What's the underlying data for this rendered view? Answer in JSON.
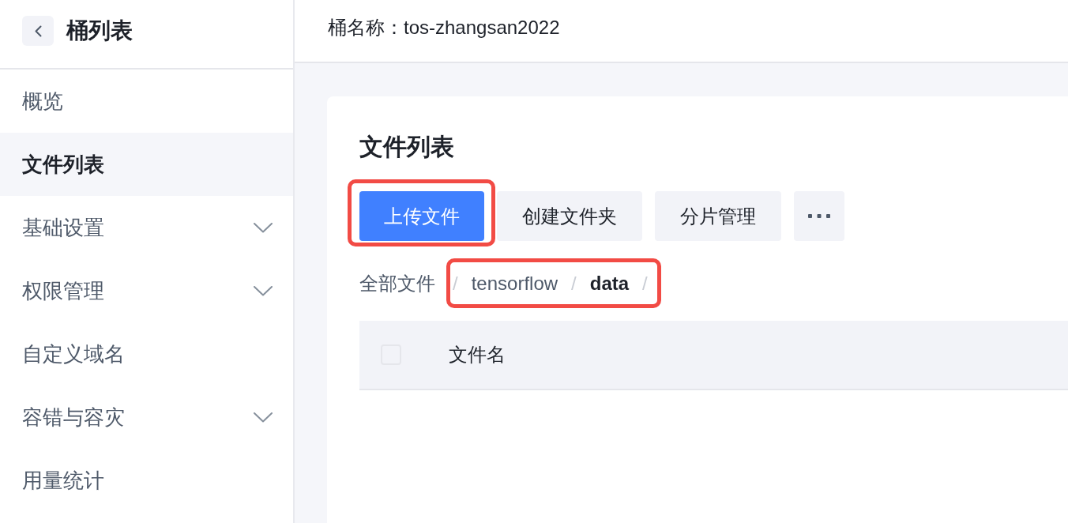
{
  "sidebar": {
    "title": "桶列表",
    "items": [
      {
        "label": "概览",
        "selected": false,
        "expandable": false
      },
      {
        "label": "文件列表",
        "selected": true,
        "expandable": false
      },
      {
        "label": "基础设置",
        "selected": false,
        "expandable": true
      },
      {
        "label": "权限管理",
        "selected": false,
        "expandable": true
      },
      {
        "label": "自定义域名",
        "selected": false,
        "expandable": false
      },
      {
        "label": "容错与容灾",
        "selected": false,
        "expandable": true
      },
      {
        "label": "用量统计",
        "selected": false,
        "expandable": false
      }
    ]
  },
  "header": {
    "title": "桶名称：tos-zhangsan2022"
  },
  "card": {
    "title": "文件列表",
    "actions": [
      {
        "kind": "primary",
        "label": "上传文件",
        "highlighted": true
      },
      {
        "kind": "default",
        "label": "创建文件夹",
        "highlighted": false
      },
      {
        "kind": "default",
        "label": "分片管理",
        "highlighted": false
      },
      {
        "kind": "more",
        "highlighted": false
      }
    ],
    "breadcrumb": [
      {
        "kind": "link",
        "text": "全部文件",
        "highlighted": false
      },
      {
        "kind": "separator",
        "text": "/",
        "highlighted": true
      },
      {
        "kind": "link",
        "text": "tensorflow",
        "highlighted": true
      },
      {
        "kind": "separator",
        "text": "/",
        "highlighted": true
      },
      {
        "kind": "current",
        "text": "data",
        "highlighted": true
      },
      {
        "kind": "separator",
        "text": "/",
        "highlighted": true
      }
    ],
    "table": {
      "select_all": {
        "checked": false
      },
      "columns": [
        "文件名"
      ]
    }
  }
}
